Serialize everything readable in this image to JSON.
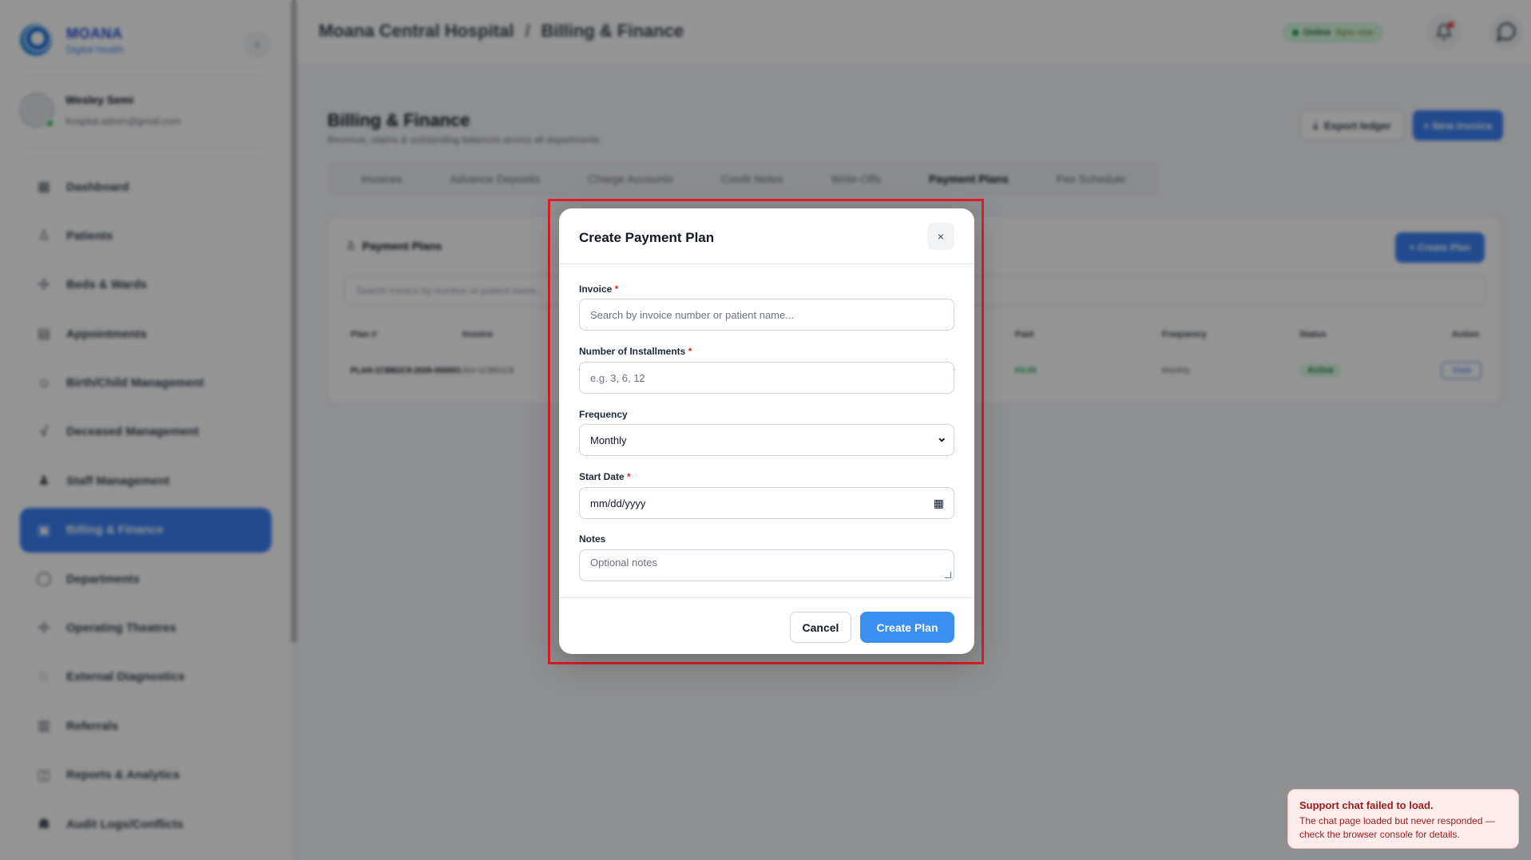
{
  "sidebar": {
    "brand_name": "MOANA",
    "brand_sub": "Digital Health",
    "collapse_glyph": "‹",
    "user_name": "Wesley Semi",
    "user_email": "hospital.admin@gmail.com",
    "items": [
      {
        "label": "Dashboard",
        "icon": "grid-icon",
        "glyph": "▦"
      },
      {
        "label": "Patients",
        "icon": "patient-icon",
        "glyph": "♙"
      },
      {
        "label": "Beds & Wards",
        "icon": "bed-icon",
        "glyph": "✢"
      },
      {
        "label": "Appointments",
        "icon": "calendar-icon",
        "glyph": "▤"
      },
      {
        "label": "Birth/Child Management",
        "icon": "baby-icon",
        "glyph": "☺"
      },
      {
        "label": "Deceased Management",
        "icon": "pulse-icon",
        "glyph": "√"
      },
      {
        "label": "Staff Management",
        "icon": "staff-icon",
        "glyph": "♟"
      },
      {
        "label": "Billing & Finance",
        "icon": "billing-icon",
        "glyph": "▣"
      },
      {
        "label": "Departments",
        "icon": "department-icon",
        "glyph": "◯"
      },
      {
        "label": "Operating Theatres",
        "icon": "theatre-icon",
        "glyph": "✢"
      },
      {
        "label": "External Diagnostics",
        "icon": "diagnostics-icon",
        "glyph": "♘"
      },
      {
        "label": "Referrals",
        "icon": "referral-icon",
        "glyph": "▥"
      },
      {
        "label": "Reports & Analytics",
        "icon": "report-icon",
        "glyph": "◫"
      },
      {
        "label": "Audit Logs/Conflicts",
        "icon": "audit-icon",
        "glyph": "☗"
      }
    ]
  },
  "header": {
    "breadcrumb_hospital": "Moana Central Hospital",
    "breadcrumb_sep": "/",
    "breadcrumb_page": "Billing & Finance",
    "status_label": "Online",
    "status_sync": "Sync now"
  },
  "page": {
    "title": "Billing & Finance",
    "subtitle": "Revenue, claims & outstanding balances across all departments",
    "export_label": "Export ledger",
    "export_glyph": "⤓",
    "new_invoice_label": "+ New invoice",
    "tabs": [
      "Invoices",
      "Advance Deposits",
      "Charge Accounts",
      "Credit Notes",
      "Write-Offs",
      "Payment Plans",
      "Fee Schedule"
    ]
  },
  "plans_card": {
    "title": "Payment Plans",
    "title_glyph": "♙",
    "create_label": "+ Create Plan",
    "search_placeholder": "Search invoice by number or patient name...",
    "columns": [
      "Plan #",
      "Invoice",
      "Paid",
      "Frequency",
      "Status",
      "Action"
    ],
    "rows": [
      {
        "plan": "PLAN-1CBB2C9-2026-000001",
        "invoice": "INV-1CBB2C9",
        "paid": "K0.00",
        "frequency": "Monthly",
        "status": "Active",
        "action": "View"
      }
    ]
  },
  "modal": {
    "title": "Create Payment Plan",
    "close_glyph": "×",
    "invoice_label": "Invoice",
    "invoice_placeholder": "Search by invoice number or patient name...",
    "installments_label": "Number of Installments",
    "installments_placeholder": "e.g. 3, 6, 12",
    "frequency_label": "Frequency",
    "frequency_value": "Monthly",
    "frequency_glyph": "⌄",
    "start_date_label": "Start Date",
    "start_date_placeholder": "mm/dd/yyyy",
    "calendar_glyph": "▦",
    "notes_label": "Notes",
    "notes_placeholder": "Optional notes",
    "required_mark": "*",
    "cancel_label": "Cancel",
    "submit_label": "Create Plan"
  },
  "toast": {
    "title": "Support chat failed to load.",
    "body": "The chat page loaded but never responded — check the browser console for details."
  },
  "colors": {
    "accent": "#3b82f6",
    "highlight_border": "#e11d24",
    "error_text": "#9b1c1c"
  }
}
